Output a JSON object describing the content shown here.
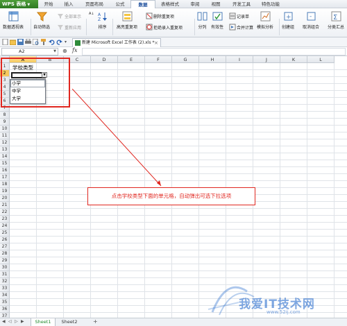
{
  "app": {
    "name": "WPS 表格"
  },
  "tabs": [
    {
      "label": "开始",
      "active": false
    },
    {
      "label": "插入",
      "active": false
    },
    {
      "label": "页面布局",
      "active": false
    },
    {
      "label": "公式",
      "active": false
    },
    {
      "label": "数据",
      "active": true
    },
    {
      "label": "表格样式",
      "active": false
    },
    {
      "label": "审阅",
      "active": false
    },
    {
      "label": "视图",
      "active": false
    },
    {
      "label": "开发工具",
      "active": false
    },
    {
      "label": "特色功能",
      "active": false
    }
  ],
  "ribbon": {
    "pivot": "数据透视表",
    "autofilter": "自动筛选",
    "show_all": "全部显示",
    "reapply": "重新应用",
    "sort": "排序",
    "highlight_dup": "高亮重复项",
    "remove_dup": "删除重复项",
    "reject_dup": "拒绝录入重复项",
    "split": "分列",
    "validity": "有效性",
    "record": "记录单",
    "consolidate": "合并计算",
    "whatif": "模拟分析",
    "group": "创建组",
    "ungroup": "取消组合",
    "subtotal": "分类汇总"
  },
  "document_tab": {
    "label": "新建 Microsoft Excel 工作表 (2).xls *"
  },
  "formula_bar": {
    "namebox": "A2",
    "fx": "fx"
  },
  "columns": [
    "A",
    "B",
    "C",
    "D",
    "E",
    "F",
    "G",
    "H",
    "I",
    "J",
    "K",
    "L"
  ],
  "rows": [
    "1",
    "2",
    "3",
    "4",
    "5",
    "6",
    "7",
    "8",
    "9",
    "10",
    "11",
    "12",
    "13",
    "14",
    "15",
    "16",
    "17",
    "18",
    "19",
    "20",
    "21",
    "22",
    "23",
    "24",
    "25",
    "26",
    "27",
    "28",
    "29",
    "30",
    "31",
    "32",
    "33",
    "34",
    "35",
    "36",
    "37"
  ],
  "cells": {
    "A1": "学校类型"
  },
  "dropdown": {
    "options": [
      "小学",
      "中学",
      "大学"
    ]
  },
  "annotation": {
    "text": "点击学校类型下面的单元格，自动弹出可选下拉选项"
  },
  "watermark": {
    "text": "我爱IT技术网",
    "url": "www.52ij.com"
  },
  "sheets": [
    {
      "label": "Sheet1",
      "active": true
    },
    {
      "label": "Sheet2",
      "active": false
    }
  ],
  "colors": {
    "accent_red": "#e0261f",
    "app_green": "#2e7a22",
    "tab_blue": "#1d4f9c"
  }
}
